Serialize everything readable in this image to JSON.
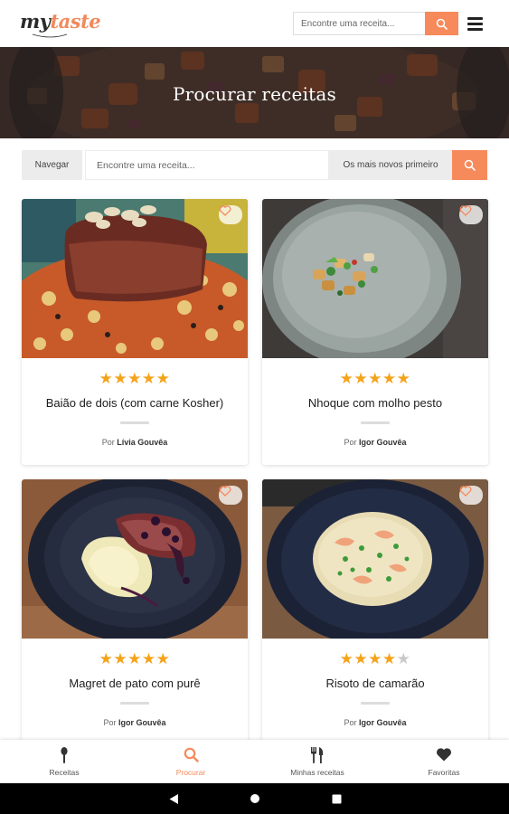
{
  "app": {
    "name_part1": "my",
    "name_part2": "taste",
    "brand_color": "#f68a5b"
  },
  "header": {
    "search_placeholder": "Encontre uma receita..."
  },
  "hero": {
    "title": "Procurar receitas"
  },
  "filters": {
    "browse_label": "Navegar",
    "search_placeholder": "Encontre uma receita...",
    "sort_label": "Os mais novos primeiro"
  },
  "recipes": [
    {
      "title": "Baião de dois (com carne Kosher)",
      "author_prefix": "Por",
      "author": "Lívia Gouvêa",
      "rating": 5,
      "image": "steak-over-beans"
    },
    {
      "title": "Nhoque com molho pesto",
      "author_prefix": "Por",
      "author": "Igor Gouvêa",
      "rating": 5,
      "image": "gnocchi-on-grey-plate"
    },
    {
      "title": "Magret de pato com purê",
      "author_prefix": "Por",
      "author": "Igor Gouvêa",
      "rating": 5,
      "image": "duck-with-puree-on-navy-plate"
    },
    {
      "title": "Risoto de camarão",
      "author_prefix": "Por",
      "author": "Igor Gouvêa",
      "rating": 4,
      "image": "shrimp-risotto-on-navy-plate"
    }
  ],
  "bottom_nav": [
    {
      "label": "Receitas",
      "icon": "spoon-icon"
    },
    {
      "label": "Procurar",
      "icon": "search-icon",
      "active": true
    },
    {
      "label": "Minhas receitas",
      "icon": "cutlery-icon"
    },
    {
      "label": "Favoritas",
      "icon": "heart-icon"
    }
  ],
  "system_nav": [
    "back-icon",
    "home-icon",
    "recents-icon"
  ]
}
